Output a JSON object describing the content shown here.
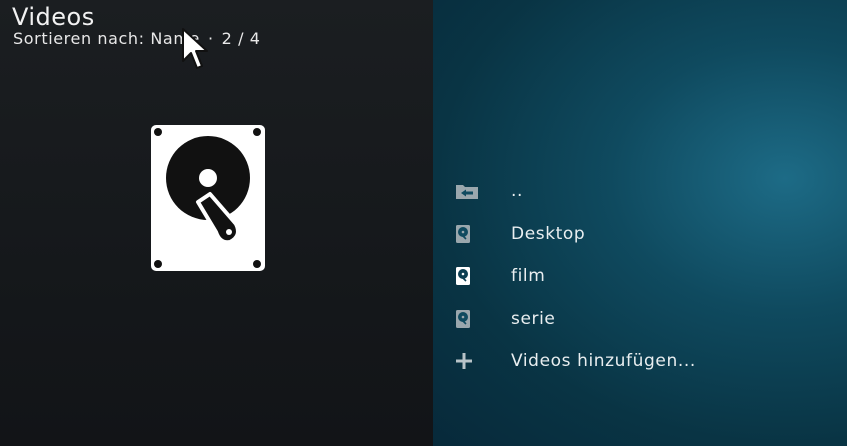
{
  "header": {
    "title": "Videos",
    "sort_label": "Sortieren nach: Name",
    "separator": "·",
    "position": "2 / 4"
  },
  "preview": {
    "icon": "harddisk-icon"
  },
  "list": {
    "items": [
      {
        "label": "..",
        "icon": "folder-back-icon"
      },
      {
        "label": "Desktop",
        "icon": "harddisk-icon"
      },
      {
        "label": "film",
        "icon": "harddisk-icon"
      },
      {
        "label": "serie",
        "icon": "harddisk-icon"
      },
      {
        "label": "Videos hinzufügen...",
        "icon": "plus-icon"
      }
    ]
  },
  "colors": {
    "left_background": "#16191c",
    "right_background": "#0f4a5f",
    "text": "#e9eef0"
  }
}
